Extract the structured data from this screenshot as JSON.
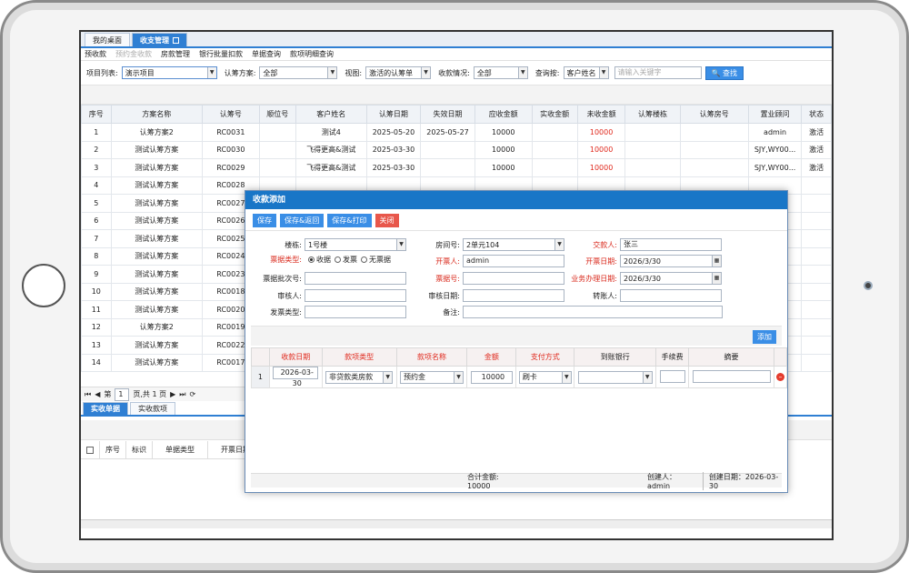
{
  "tabs": [
    {
      "label": "我的桌面"
    },
    {
      "label": "收支管理"
    }
  ],
  "menu": [
    "预收款",
    "预约金收款",
    "房款管理",
    "银行批量扣款",
    "单据查询",
    "款项明细查询"
  ],
  "filters": {
    "project_label": "项目列表:",
    "project_value": "演示项目",
    "plan_label": "认筹方案:",
    "plan_value": "全部",
    "view_label": "视图:",
    "view_value": "激活的认筹单",
    "receipt_label": "收款情况:",
    "receipt_value": "全部",
    "query_label": "查询按:",
    "query_value": "客户姓名",
    "search_placeholder": "请输入关键字",
    "search_button": "查找"
  },
  "table": {
    "headers": [
      "序号",
      "方案名称",
      "认筹号",
      "顺位号",
      "客户姓名",
      "认筹日期",
      "失效日期",
      "应收金额",
      "实收金额",
      "未收金额",
      "认筹楼栋",
      "认筹房号",
      "置业顾问",
      "状态"
    ],
    "rows": [
      [
        "1",
        "认筹方案2",
        "RC0031",
        "",
        "测试4",
        "2025-05-20",
        "2025-05-27",
        "10000",
        "",
        "10000",
        "",
        "",
        "admin",
        "激活"
      ],
      [
        "2",
        "测试认筹方案",
        "RC0030",
        "",
        "飞得更高&测试",
        "2025-03-30",
        "",
        "10000",
        "",
        "10000",
        "",
        "",
        "SJY,WY00...",
        "激活"
      ],
      [
        "3",
        "测试认筹方案",
        "RC0029",
        "",
        "飞得更高&测试",
        "2025-03-30",
        "",
        "10000",
        "",
        "10000",
        "",
        "",
        "SJY,WY00...",
        "激活"
      ],
      [
        "4",
        "测试认筹方案",
        "RC0028",
        "",
        "",
        "",
        "",
        "",
        "",
        "",
        "",
        "",
        "",
        ""
      ],
      [
        "5",
        "测试认筹方案",
        "RC0027",
        "",
        "",
        "",
        "",
        "",
        "",
        "",
        "",
        "",
        "",
        ""
      ],
      [
        "6",
        "测试认筹方案",
        "RC0026",
        "",
        "",
        "",
        "",
        "",
        "",
        "",
        "",
        "",
        "",
        ""
      ],
      [
        "7",
        "测试认筹方案",
        "RC0025",
        "",
        "",
        "",
        "",
        "",
        "",
        "",
        "",
        "",
        "",
        ""
      ],
      [
        "8",
        "测试认筹方案",
        "RC0024",
        "",
        "",
        "",
        "",
        "",
        "",
        "",
        "",
        "",
        "",
        ""
      ],
      [
        "9",
        "测试认筹方案",
        "RC0023",
        "",
        "",
        "",
        "",
        "",
        "",
        "",
        "",
        "",
        "",
        ""
      ],
      [
        "10",
        "测试认筹方案",
        "RC0018",
        "",
        "",
        "",
        "",
        "",
        "",
        "",
        "",
        "",
        "",
        ""
      ],
      [
        "11",
        "测试认筹方案",
        "RC0020",
        "",
        "",
        "",
        "",
        "",
        "",
        "",
        "",
        "",
        "",
        ""
      ],
      [
        "12",
        "认筹方案2",
        "RC0019",
        "",
        "",
        "",
        "",
        "",
        "",
        "",
        "",
        "",
        "",
        ""
      ],
      [
        "13",
        "测试认筹方案",
        "RC0022",
        "",
        "",
        "",
        "",
        "",
        "",
        "",
        "",
        "",
        "",
        ""
      ],
      [
        "14",
        "测试认筹方案",
        "RC0017",
        "",
        "",
        "",
        "",
        "",
        "",
        "",
        "",
        "",
        "",
        ""
      ]
    ]
  },
  "pager": {
    "page_prefix": "第",
    "page_value": "1",
    "page_suffix": "页,共 1 页"
  },
  "subtabs": [
    "实收单据",
    "实收款项"
  ],
  "bottom_headers": [
    "序号",
    "标识",
    "单据类型",
    "开票日期"
  ],
  "modal": {
    "title": "收款添加",
    "buttons": {
      "save": "保存",
      "save_return": "保存&返回",
      "save_print": "保存&打印",
      "close": "关闭"
    },
    "building_label": "楼栋:",
    "building_value": "1号楼",
    "room_label": "房间号:",
    "room_value": "2单元104",
    "payer_label": "交款人:",
    "payer_value": "张三",
    "ticket_type_label": "票据类型:",
    "ticket_options": [
      "收据",
      "发票",
      "无票据"
    ],
    "drawer_label": "开票人:",
    "drawer_value": "admin",
    "issue_date_label": "开票日期:",
    "issue_date_value": "2026/3/30",
    "batch_label": "票据批次号:",
    "batch_value": "",
    "ticket_no_label": "票据号:",
    "ticket_no_value": "",
    "biz_date_label": "业务办理日期:",
    "biz_date_value": "2026/3/30",
    "auditor_label": "审核人:",
    "audit_date_label": "审核日期:",
    "transfer_label": "转账人:",
    "invoice_type_label": "发票类型:",
    "remark_label": "备注:",
    "add_button": "添加",
    "detail_headers": [
      "收款日期",
      "款项类型",
      "款项名称",
      "金额",
      "支付方式",
      "到账银行",
      "手续费",
      "摘要"
    ],
    "detail_row": {
      "index": "1",
      "date": "2026-03-30",
      "type": "非贷款类房款",
      "name": "预约金",
      "amount": "10000",
      "method": "刷卡",
      "bank": "",
      "fee": "",
      "summary": ""
    },
    "total_label": "合计金额: 10000",
    "creator": "创建人：admin",
    "created_date": "创建日期：2026-03-30"
  }
}
